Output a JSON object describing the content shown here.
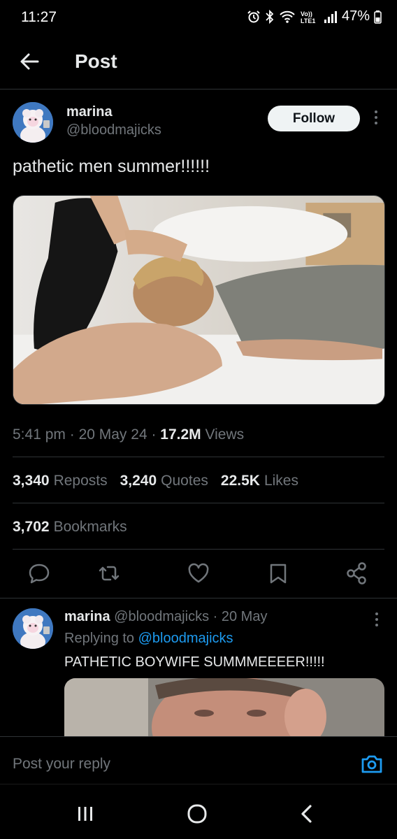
{
  "status_bar": {
    "time": "11:27",
    "battery": "47%",
    "icons": [
      "alarm-icon",
      "bluetooth-icon",
      "wifi-icon",
      "volte-icon",
      "signal-icon",
      "battery-icon"
    ],
    "volte_text": "Vo)) LTE1"
  },
  "header": {
    "title": "Post",
    "back_icon": "arrow-left-icon"
  },
  "post": {
    "display_name": "marina",
    "handle": "@bloodmajicks",
    "follow_label": "Follow",
    "text": "pathetic men summer!!!!!!",
    "image_alt": "photo",
    "time": "5:41 pm",
    "date": "20 May 24",
    "views_count": "17.2M",
    "views_label": "Views",
    "stats": {
      "reposts_count": "3,340",
      "reposts_label": "Reposts",
      "quotes_count": "3,240",
      "quotes_label": "Quotes",
      "likes_count": "22.5K",
      "likes_label": "Likes",
      "bookmarks_count": "3,702",
      "bookmarks_label": "Bookmarks"
    },
    "actions": [
      "reply-icon",
      "repost-icon",
      "like-icon",
      "bookmark-icon",
      "share-icon"
    ]
  },
  "reply": {
    "display_name": "marina",
    "handle": "@bloodmajicks",
    "date": "20 May",
    "replying_prefix": "Replying to",
    "replying_to": "@bloodmajicks",
    "text": "PATHETIC BOYWIFE SUMMMEEEER!!!!!"
  },
  "compose": {
    "placeholder": "Post your reply",
    "camera_icon": "camera-icon"
  },
  "nav": [
    "recent-apps-icon",
    "home-icon",
    "back-icon"
  ],
  "colors": {
    "background": "#000000",
    "text": "#e7e9ea",
    "muted": "#71767b",
    "link": "#1d9bf0",
    "divider": "#2f3336"
  }
}
